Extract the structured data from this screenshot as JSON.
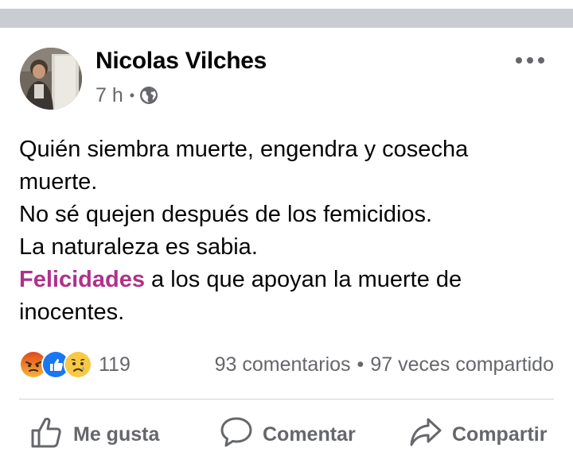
{
  "post": {
    "author": "Nicolas Vilches",
    "time": "7 h",
    "meta_separator": "•",
    "audience_icon": "globe-icon",
    "more_icon": "more-options-icon",
    "text_lines": [
      "Quién siembra muerte, engendra y cosecha",
      "muerte.",
      "No sé quejen después de los femicidios.",
      "La naturaleza es sabia."
    ],
    "last_line": {
      "hashtag": "Felicidades",
      "rest": " a los que apoyan la muerte de",
      "continuation": "inocentes."
    }
  },
  "reactions": {
    "icons": [
      "angry-reaction-icon",
      "like-reaction-icon",
      "sad-reaction-icon"
    ],
    "count": "119"
  },
  "stats": {
    "comments": "93 comentarios",
    "separator": "•",
    "shares": "97 veces compartido"
  },
  "actions": {
    "like": "Me gusta",
    "comment": "Comentar",
    "share": "Compartir"
  },
  "colors": {
    "hashtag": "#b0318a",
    "secondary_text": "#65676b",
    "like_blue": "#1877f2",
    "angry_orange": "#e9710f"
  }
}
